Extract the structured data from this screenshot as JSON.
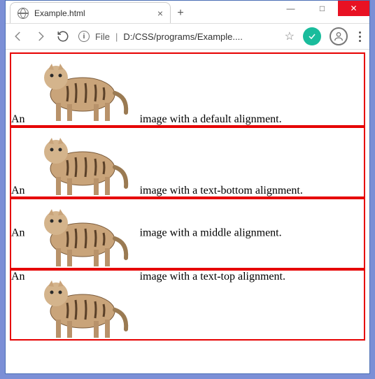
{
  "window": {
    "tab_title": "Example.html",
    "address": {
      "label": "File",
      "url": "D:/CSS/programs/Example...."
    }
  },
  "rows": {
    "r1": {
      "before": "An",
      "after": "image with a default alignment."
    },
    "r2": {
      "before": "An",
      "after": "image with a text-bottom alignment."
    },
    "r3": {
      "before": "An",
      "after": "image with a middle alignment."
    },
    "r4": {
      "before": "An",
      "after": "image with a text-top alignment."
    }
  }
}
